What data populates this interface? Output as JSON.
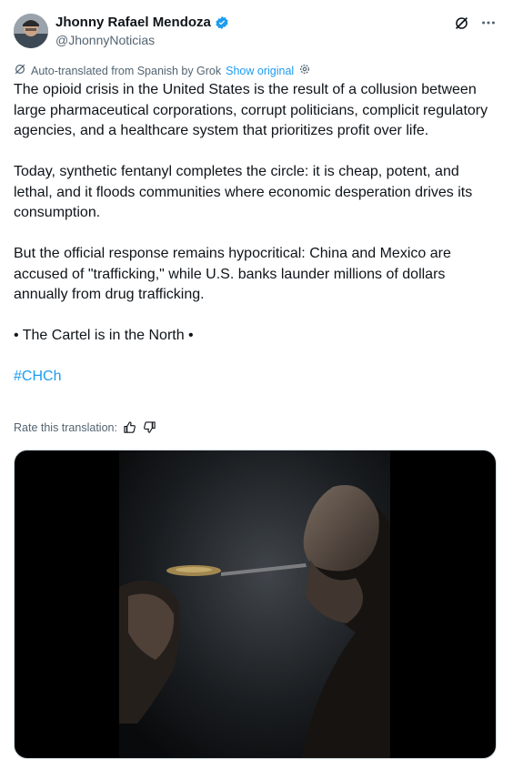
{
  "author": {
    "name": "Jhonny Rafael Mendoza",
    "handle": "@JhonnyNoticias",
    "verified": true
  },
  "translation": {
    "label": "Auto-translated from Spanish by Grok",
    "show_original": "Show original"
  },
  "post": {
    "paragraph1": "The opioid crisis in the United States is the result of a collusion between large pharmaceutical corporations, corrupt politicians, complicit regulatory agencies, and a healthcare system that prioritizes profit over life.",
    "paragraph2": "Today, synthetic fentanyl completes the circle: it is cheap, potent, and lethal, and it floods communities where economic desperation drives its consumption.",
    "paragraph3": "But the official response remains hypocritical: China and Mexico are accused of \"trafficking,\" while U.S. banks launder millions of dollars annually from drug trafficking.",
    "paragraph4": "• The Cartel is in the North •",
    "hashtag": "#CHCh"
  },
  "rate": {
    "label": "Rate this translation:"
  },
  "colors": {
    "accent": "#1d9bf0",
    "secondary_text": "#536471",
    "text": "#0f1419"
  },
  "icons": [
    "grok-icon",
    "more-icon",
    "verified-badge-icon",
    "translate-icon",
    "settings-icon",
    "thumbs-up-icon",
    "thumbs-down-icon"
  ]
}
